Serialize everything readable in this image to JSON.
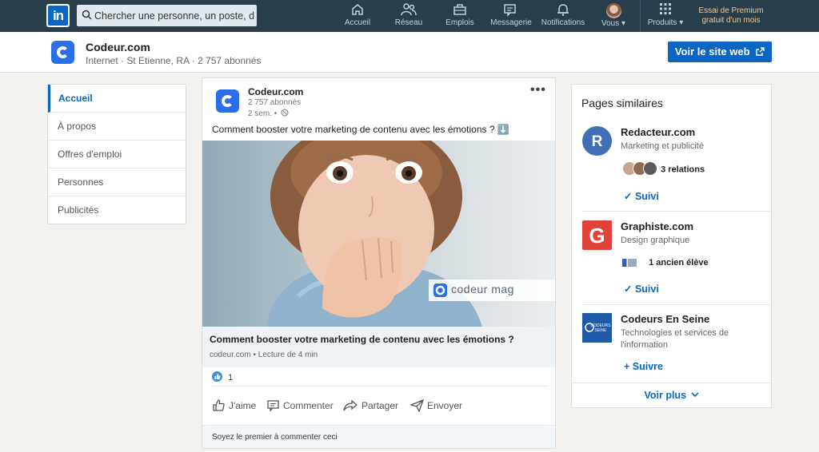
{
  "nav": {
    "logo": "in",
    "search_placeholder": "Chercher une personne, un poste, du",
    "items": [
      {
        "label": "Accueil",
        "icon": "home-icon"
      },
      {
        "label": "Réseau",
        "icon": "network-icon"
      },
      {
        "label": "Emplois",
        "icon": "briefcase-icon"
      },
      {
        "label": "Messagerie",
        "icon": "messaging-icon"
      },
      {
        "label": "Notifications",
        "icon": "bell-icon"
      },
      {
        "label": "Vous",
        "icon": "avatar"
      },
      {
        "label": "Produits",
        "icon": "grid-icon"
      }
    ],
    "premium_line1": "Essai de Premium",
    "premium_line2": "gratuit d'un mois"
  },
  "company": {
    "name": "Codeur.com",
    "meta": "Internet · St Etienne, RA · 2 757 abonnés",
    "visit_button": "Voir le site web"
  },
  "left_menu": [
    {
      "label": "Accueil",
      "active": true
    },
    {
      "label": "À propos"
    },
    {
      "label": "Offres d'emploi"
    },
    {
      "label": "Personnes"
    },
    {
      "label": "Publicités"
    }
  ],
  "post": {
    "author": "Codeur.com",
    "followers": "2 757 abonnés",
    "time": "2 sem. •",
    "text": "Comment booster votre marketing de contenu avec les émotions ? ⬇️",
    "image_watermark": "codeur mag",
    "link_title": "Comment booster votre marketing de contenu avec les émotions ?",
    "link_meta": "codeur.com • Lecture de 4 min",
    "reactions": "1",
    "actions": {
      "like": "J'aime",
      "comment": "Commenter",
      "share": "Partager",
      "send": "Envoyer"
    },
    "footer": "Soyez le premier à commenter ceci"
  },
  "similar": {
    "title": "Pages similaires",
    "pages": [
      {
        "name": "Redacteur.com",
        "subtitle": "Marketing et publicité",
        "relation": "3 relations",
        "button": "✓ Suivi",
        "logo_color": "#3f6fb5",
        "logo_letter": "R"
      },
      {
        "name": "Graphiste.com",
        "subtitle": "Design graphique",
        "relation": "1 ancien élève",
        "button": "✓ Suivi",
        "logo_color": "#e0433a",
        "logo_letter": "G"
      },
      {
        "name": "Codeurs En Seine",
        "subtitle": "Technologies et services de l'information",
        "button": "+ Suivre",
        "logo_color": "#1f5aa6",
        "logo_text_line1": "CODEURS",
        "logo_text_line2": "SEINE"
      }
    ],
    "more": "Voir plus"
  }
}
